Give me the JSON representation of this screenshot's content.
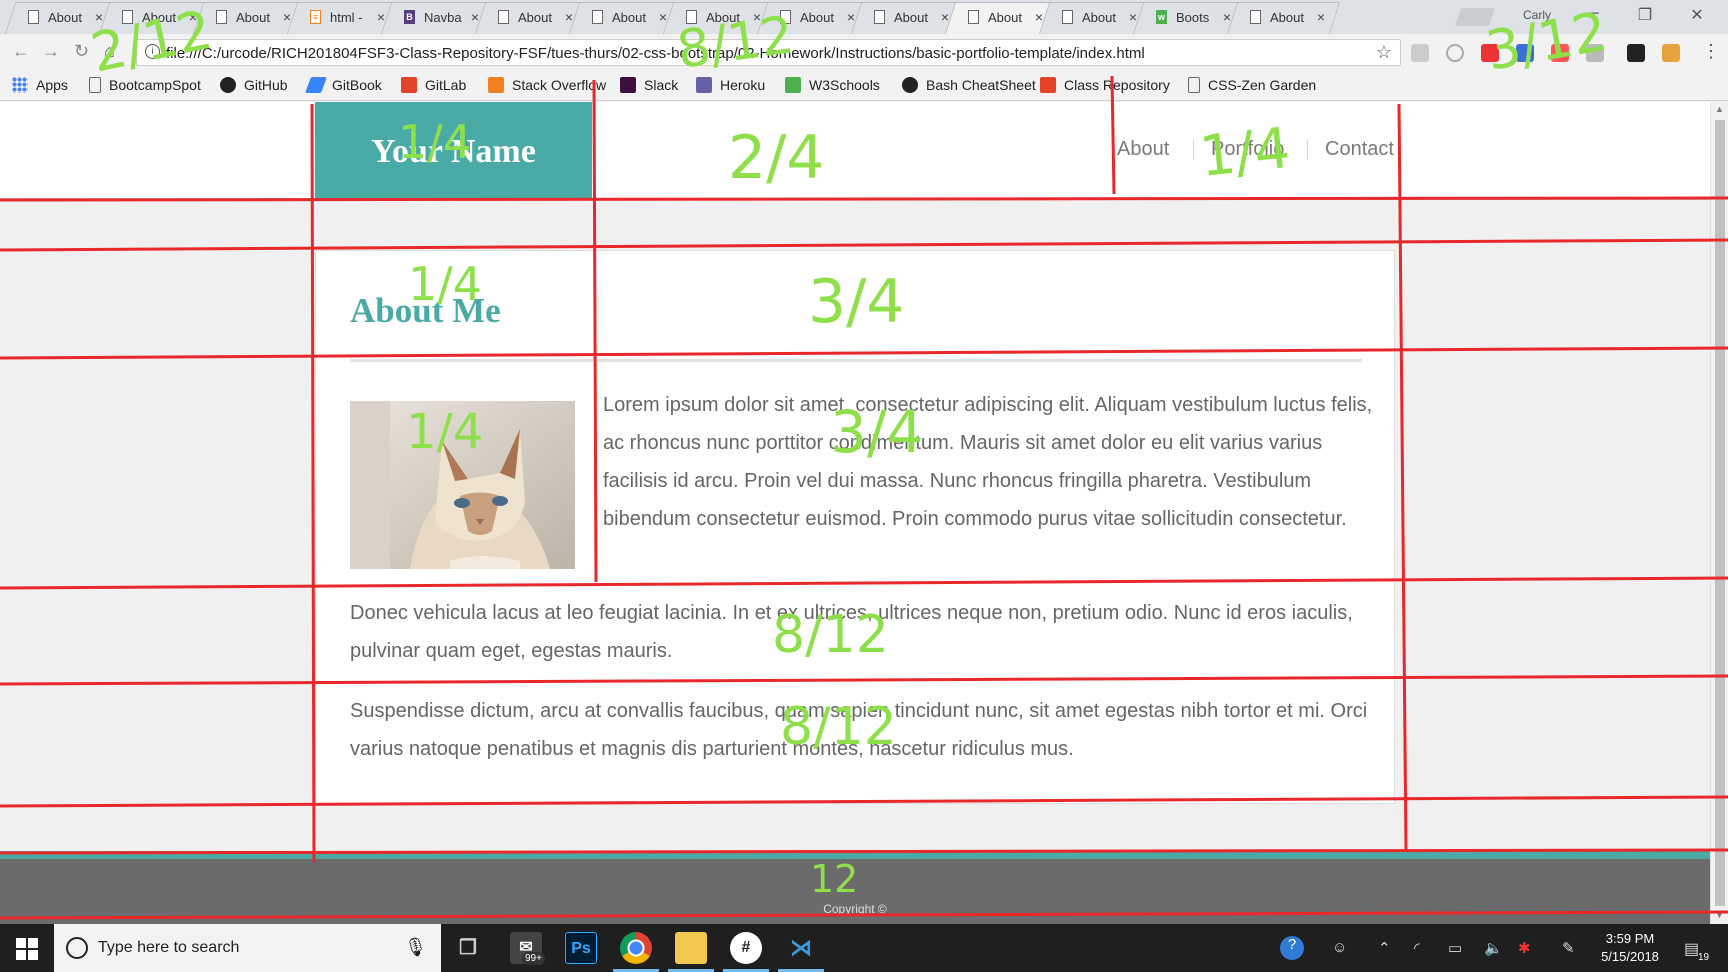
{
  "browser": {
    "tabs": [
      {
        "label": "About",
        "icon": "page-icon"
      },
      {
        "label": "About",
        "icon": "page-icon"
      },
      {
        "label": "About",
        "icon": "page-icon"
      },
      {
        "label": "html -",
        "icon": "stackoverflow-icon"
      },
      {
        "label": "Navba",
        "icon": "bootstrap-icon"
      },
      {
        "label": "About",
        "icon": "page-icon"
      },
      {
        "label": "About",
        "icon": "page-icon"
      },
      {
        "label": "About",
        "icon": "page-icon"
      },
      {
        "label": "About",
        "icon": "page-icon"
      },
      {
        "label": "About",
        "icon": "page-icon"
      },
      {
        "label": "About",
        "icon": "page-icon",
        "active": true
      },
      {
        "label": "About",
        "icon": "page-icon"
      },
      {
        "label": "Boots",
        "icon": "w3schools-icon"
      },
      {
        "label": "About",
        "icon": "page-icon"
      }
    ],
    "profile_name": "Carly",
    "address": "file:///C:/urcode/RICH201804FSF3-Class-Repository-FSF/tues-thurs/02-css-bootstrap/02-Homework/Instructions/basic-portfolio-template/index.html",
    "bookmarks": [
      {
        "label": "Apps",
        "icon": "apps-grid-icon",
        "color": "#4285f4"
      },
      {
        "label": "BootcampSpot",
        "icon": "page-icon",
        "color": "#ffffff"
      },
      {
        "label": "GitHub",
        "icon": "github-icon",
        "color": "#222222"
      },
      {
        "label": "GitBook",
        "icon": "gitbook-icon",
        "color": "#3884ff"
      },
      {
        "label": "GitLab",
        "icon": "gitlab-icon",
        "color": "#e24329"
      },
      {
        "label": "Stack Overflow",
        "icon": "stackoverflow-icon",
        "color": "#f48024"
      },
      {
        "label": "Slack",
        "icon": "slack-icon",
        "color": "#3f0e40"
      },
      {
        "label": "Heroku",
        "icon": "heroku-icon",
        "color": "#6762a6"
      },
      {
        "label": "W3Schools",
        "icon": "w3schools-icon",
        "color": "#4caf50"
      },
      {
        "label": "Bash CheatSheet",
        "icon": "github-icon",
        "color": "#222222"
      },
      {
        "label": "Class Repository",
        "icon": "gitlab-icon",
        "color": "#e24329"
      },
      {
        "label": "CSS-Zen Garden",
        "icon": "page-icon",
        "color": "#ffffff"
      }
    ]
  },
  "site": {
    "brand": "Your Name",
    "nav": [
      "About",
      "Portfolio",
      "Contact"
    ],
    "about_title": "About Me",
    "paragraph1": "Lorem ipsum dolor sit amet, consectetur adipiscing elit. Aliquam vestibulum luctus felis, ac rhoncus nunc porttitor condimentum. Mauris sit amet dolor eu elit varius varius facilisis id arcu. Proin vel dui massa. Nunc rhoncus fringilla pharetra. Vestibulum bibendum consectetur euismod. Proin commodo purus vitae sollicitudin consectetur.",
    "paragraph2": "Donec vehicula lacus at leo feugiat lacinia. In et ex ultrices, ultrices neque non, pretium odio. Nunc id eros iaculis, pulvinar quam eget, egestas mauris.",
    "paragraph3": "Suspendisse dictum, arcu at convallis faucibus, quam sapien tincidunt nunc, sit amet egestas nibh tortor et mi. Orci varius natoque penatibus et magnis dis parturient montes, nascetur ridiculus mus.",
    "copyright": "Copyright ©",
    "accent_color": "#4aaaa5"
  },
  "annotations": {
    "grid_notes": [
      "2/12",
      "8/12",
      "3/12",
      "1/4",
      "2/4",
      "1/4",
      "1/4",
      "3/4",
      "1/4",
      "3/4",
      "8/12",
      "8/12",
      "12"
    ],
    "line_color": "#e8282b",
    "note_color": "#8ee04a"
  },
  "taskbar": {
    "search_placeholder": "Type here to search",
    "mail_badge": "99+",
    "notification_count": "19",
    "time": "3:59 PM",
    "date": "5/15/2018"
  }
}
